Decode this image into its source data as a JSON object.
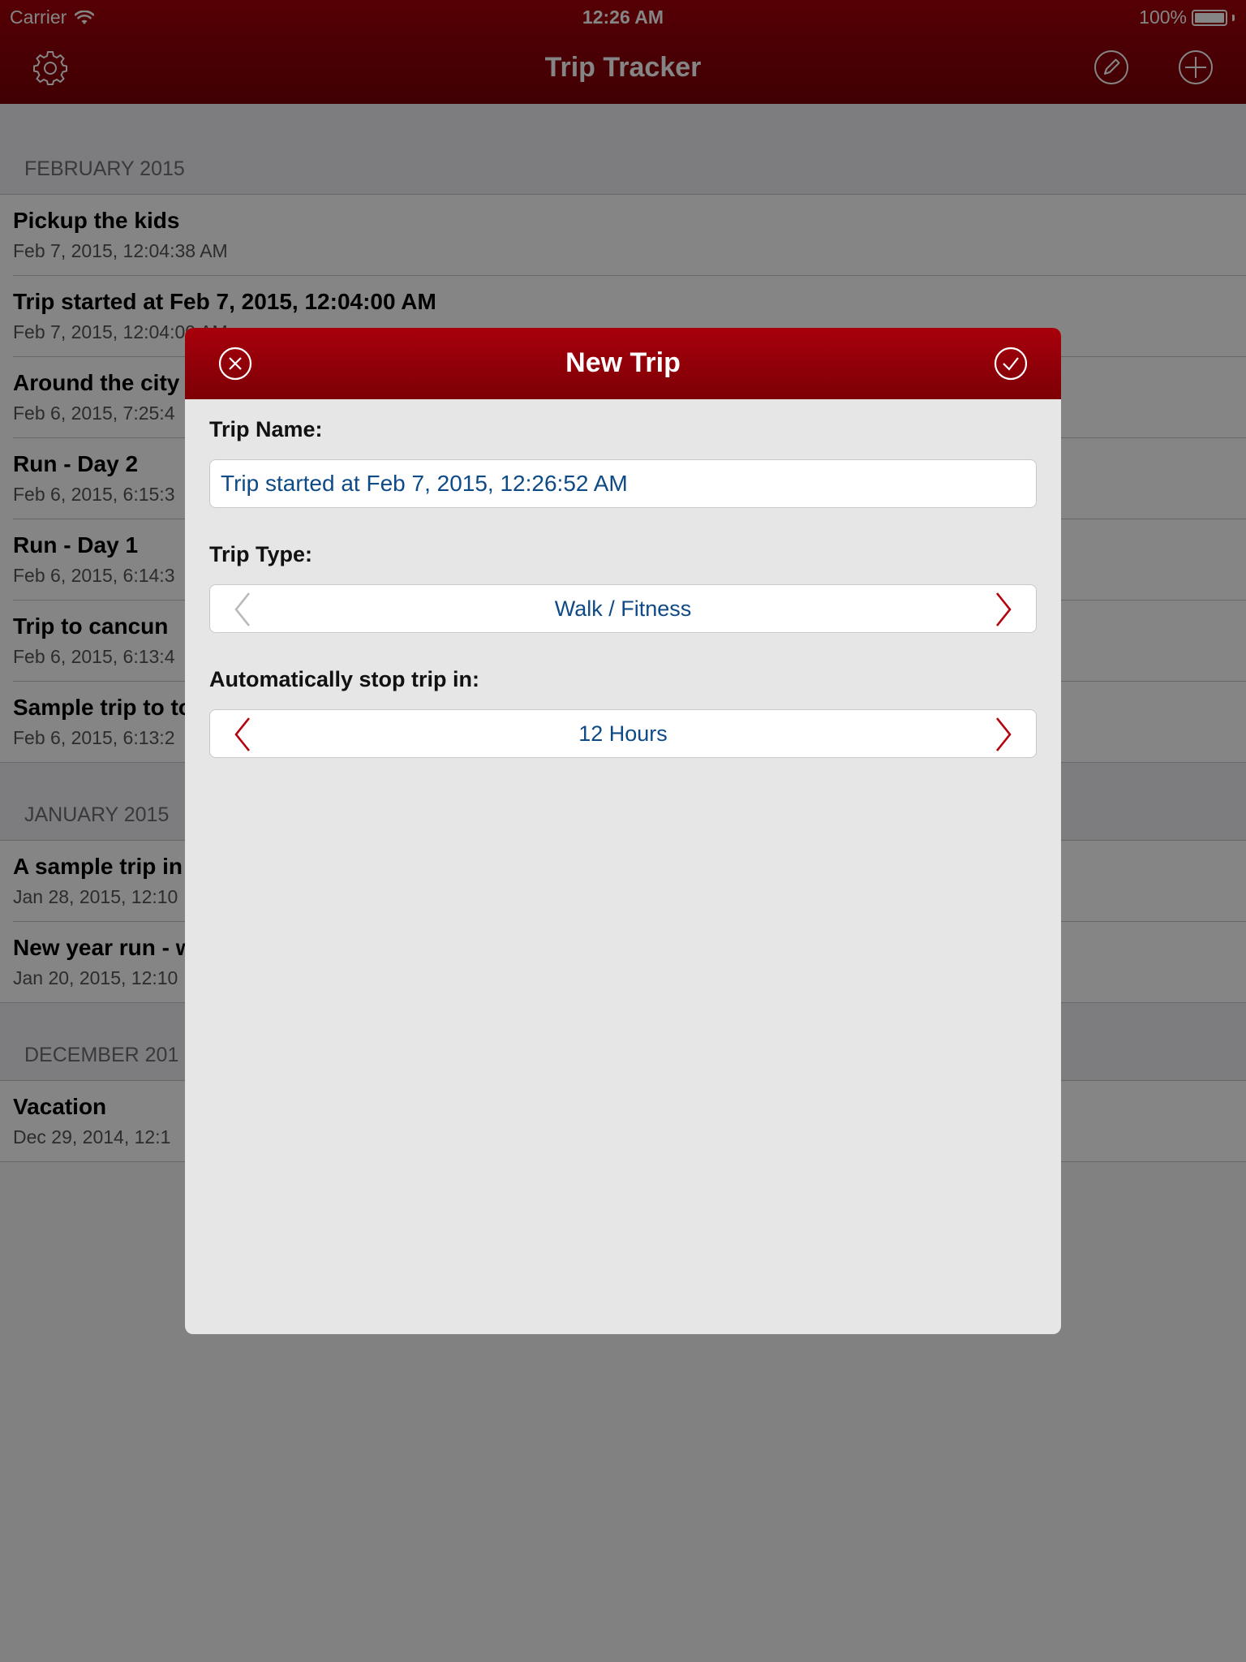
{
  "status_bar": {
    "carrier": "Carrier",
    "time": "12:26 AM",
    "battery": "100%",
    "battery_level": 1.0
  },
  "nav": {
    "title": "Trip Tracker",
    "icons": {
      "left": "gear-icon",
      "edit": "pencil-circle-icon",
      "add": "plus-circle-icon"
    }
  },
  "sections": [
    {
      "header": "FEBRUARY 2015",
      "trips": [
        {
          "name": "Pickup the kids",
          "date": "Feb 7, 2015, 12:04:38 AM"
        },
        {
          "name": "Trip started at Feb 7, 2015, 12:04:00 AM",
          "date": "Feb 7, 2015, 12:04:00 AM"
        },
        {
          "name": "Around the city",
          "date": "Feb 6, 2015, 7:25:4"
        },
        {
          "name": "Run - Day 2",
          "date": "Feb 6, 2015, 6:15:3"
        },
        {
          "name": "Run - Day 1",
          "date": "Feb 6, 2015, 6:14:3"
        },
        {
          "name": "Trip to cancun",
          "date": "Feb 6, 2015, 6:13:4"
        },
        {
          "name": "Sample trip to to",
          "date": "Feb 6, 2015, 6:13:2"
        }
      ]
    },
    {
      "header": "JANUARY 2015",
      "trips": [
        {
          "name": "A sample trip in",
          "date": "Jan 28, 2015, 12:10"
        },
        {
          "name": "New year run - w",
          "date": "Jan 20, 2015, 12:10"
        }
      ]
    },
    {
      "header": "DECEMBER 201",
      "trips": [
        {
          "name": "Vacation",
          "date": "Dec 29, 2014, 12:1"
        }
      ]
    }
  ],
  "modal": {
    "title": "New Trip",
    "cancel_icon": "close-circle-icon",
    "confirm_icon": "check-circle-icon",
    "trip_name_label": "Trip Name:",
    "trip_name_value": "Trip started at Feb 7, 2015, 12:26:52 AM",
    "trip_type_label": "Trip Type:",
    "trip_type_value": "Walk / Fitness",
    "auto_stop_label": "Automatically stop trip in:",
    "auto_stop_value": "12 Hours"
  },
  "colors": {
    "brand_red": "#9a0009",
    "value_blue": "#0e4a86",
    "arrow_active": "#b5000d",
    "arrow_disabled": "#b9b9b9"
  }
}
